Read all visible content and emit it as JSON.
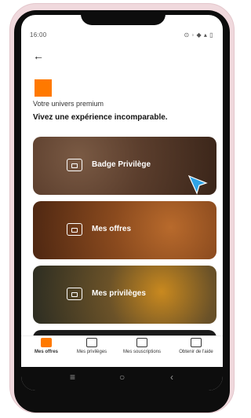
{
  "status": {
    "time": "16:00",
    "icons_right": "⊙ ◦ ◆ ▴ ▯"
  },
  "header": {
    "back_icon": "←"
  },
  "intro": {
    "eyebrow": "Votre univers premium",
    "headline": "Vivez une expérience incomparable."
  },
  "cards": [
    {
      "label": "Badge Privilège",
      "icon": "badge-icon"
    },
    {
      "label": "Mes offres",
      "icon": "offers-icon"
    },
    {
      "label": "Mes privilèges",
      "icon": "privileges-icon"
    }
  ],
  "tabs": [
    {
      "label": "Mes offres",
      "active": true,
      "icon": "offers-tab-icon"
    },
    {
      "label": "Mes privilèges",
      "active": false,
      "icon": "privileges-tab-icon"
    },
    {
      "label": "Mes souscriptions",
      "active": false,
      "icon": "subscriptions-tab-icon"
    },
    {
      "label": "Obtenir de l'aide",
      "active": false,
      "icon": "help-tab-icon"
    }
  ],
  "navbar": {
    "menu": "≡",
    "home": "○",
    "back": "‹"
  },
  "colors": {
    "brand": "#ff7900",
    "tap_cursor": "#2fa3e6"
  }
}
